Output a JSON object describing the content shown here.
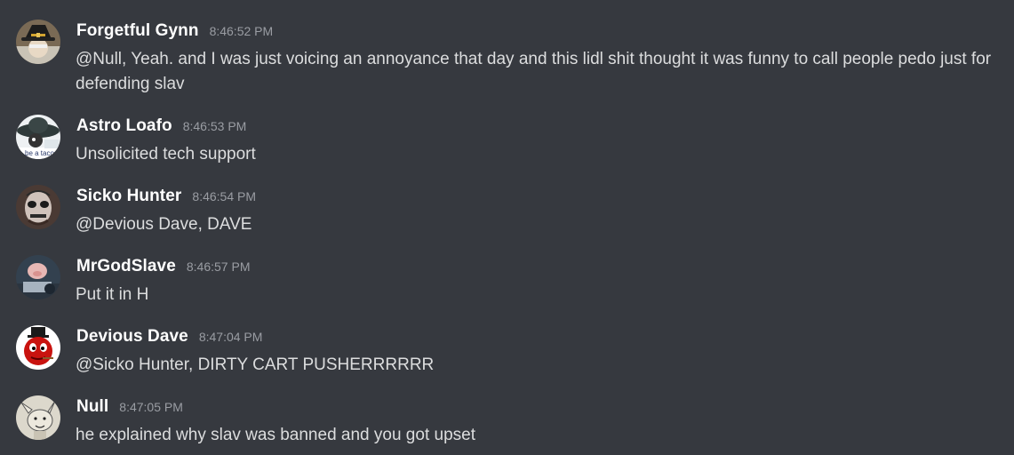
{
  "messages": [
    {
      "username": "Forgetful Gynn",
      "timestamp": "8:46:52 PM",
      "text": "@Null, Yeah. and I was just voicing an annoyance that day and this lidl shit thought it was funny to call people pedo just for defending slav",
      "avatar_icon": "witch-hat-avatar-icon",
      "color": "#ffffff"
    },
    {
      "username": "Astro Loafo",
      "timestamp": "8:46:53 PM",
      "text": "Unsolicited tech support",
      "avatar_icon": "sombrero-avatar-icon",
      "color": "#ffffff"
    },
    {
      "username": "Sicko Hunter",
      "timestamp": "8:46:54 PM",
      "text": "@Devious Dave, DAVE",
      "avatar_icon": "face-paint-avatar-icon",
      "color": "#ffffff"
    },
    {
      "username": "MrGodSlave",
      "timestamp": "8:46:57 PM",
      "text": "Put it in H",
      "avatar_icon": "pig-avatar-icon",
      "color": "#ffffff"
    },
    {
      "username": "Devious Dave",
      "timestamp": "8:47:04 PM",
      "text": "@Sicko Hunter, DIRTY CART PUSHERRRRRR",
      "avatar_icon": "red-devil-avatar-icon",
      "color": "#ffffff"
    },
    {
      "username": "Null",
      "timestamp": "8:47:05 PM",
      "text": "he explained why slav was banned and you got upset",
      "avatar_icon": "cartoon-goat-avatar-icon",
      "color": "#ffffff"
    }
  ]
}
